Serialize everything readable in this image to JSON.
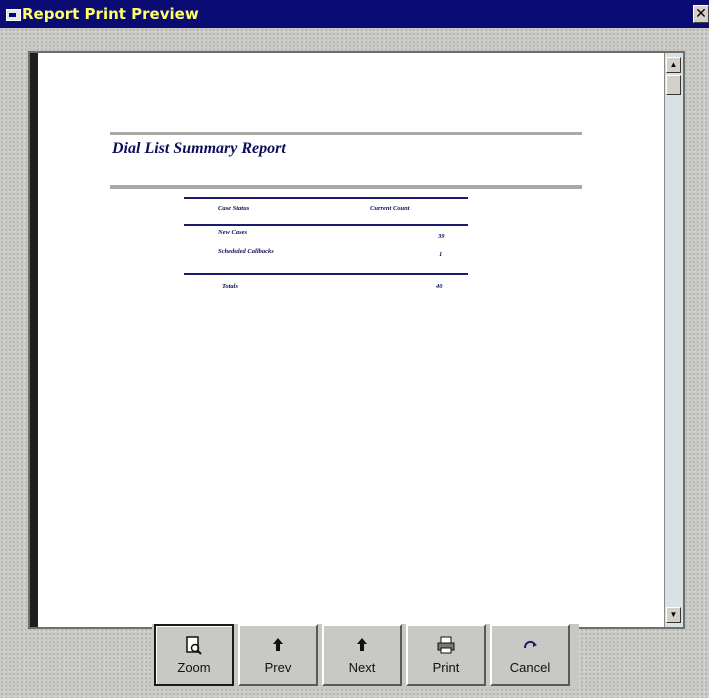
{
  "window": {
    "title": "Report Print Preview",
    "close_glyph": "✕"
  },
  "report": {
    "title": "Dial List Summary Report",
    "columns": {
      "status": "Case Status",
      "count": "Current Count"
    },
    "rows": [
      {
        "label": "New Cases",
        "value": "39"
      },
      {
        "label": "Scheduled Callbacks",
        "value": "1"
      }
    ],
    "totals": {
      "label": "Totals",
      "value": "40"
    }
  },
  "scrollbar": {
    "up_glyph": "▲",
    "down_glyph": "▼"
  },
  "toolbar": {
    "buttons": [
      {
        "label": "Zoom",
        "icon": "zoom-page-icon"
      },
      {
        "label": "Prev",
        "icon": "prev-arrow-icon"
      },
      {
        "label": "Next",
        "icon": "next-arrow-icon"
      },
      {
        "label": "Print",
        "icon": "printer-icon"
      },
      {
        "label": "Cancel",
        "icon": "cancel-icon"
      }
    ]
  },
  "colors": {
    "titlebar": "#0b0b74",
    "title_text": "#ffff66",
    "report_navy": "#1a1a6e"
  }
}
